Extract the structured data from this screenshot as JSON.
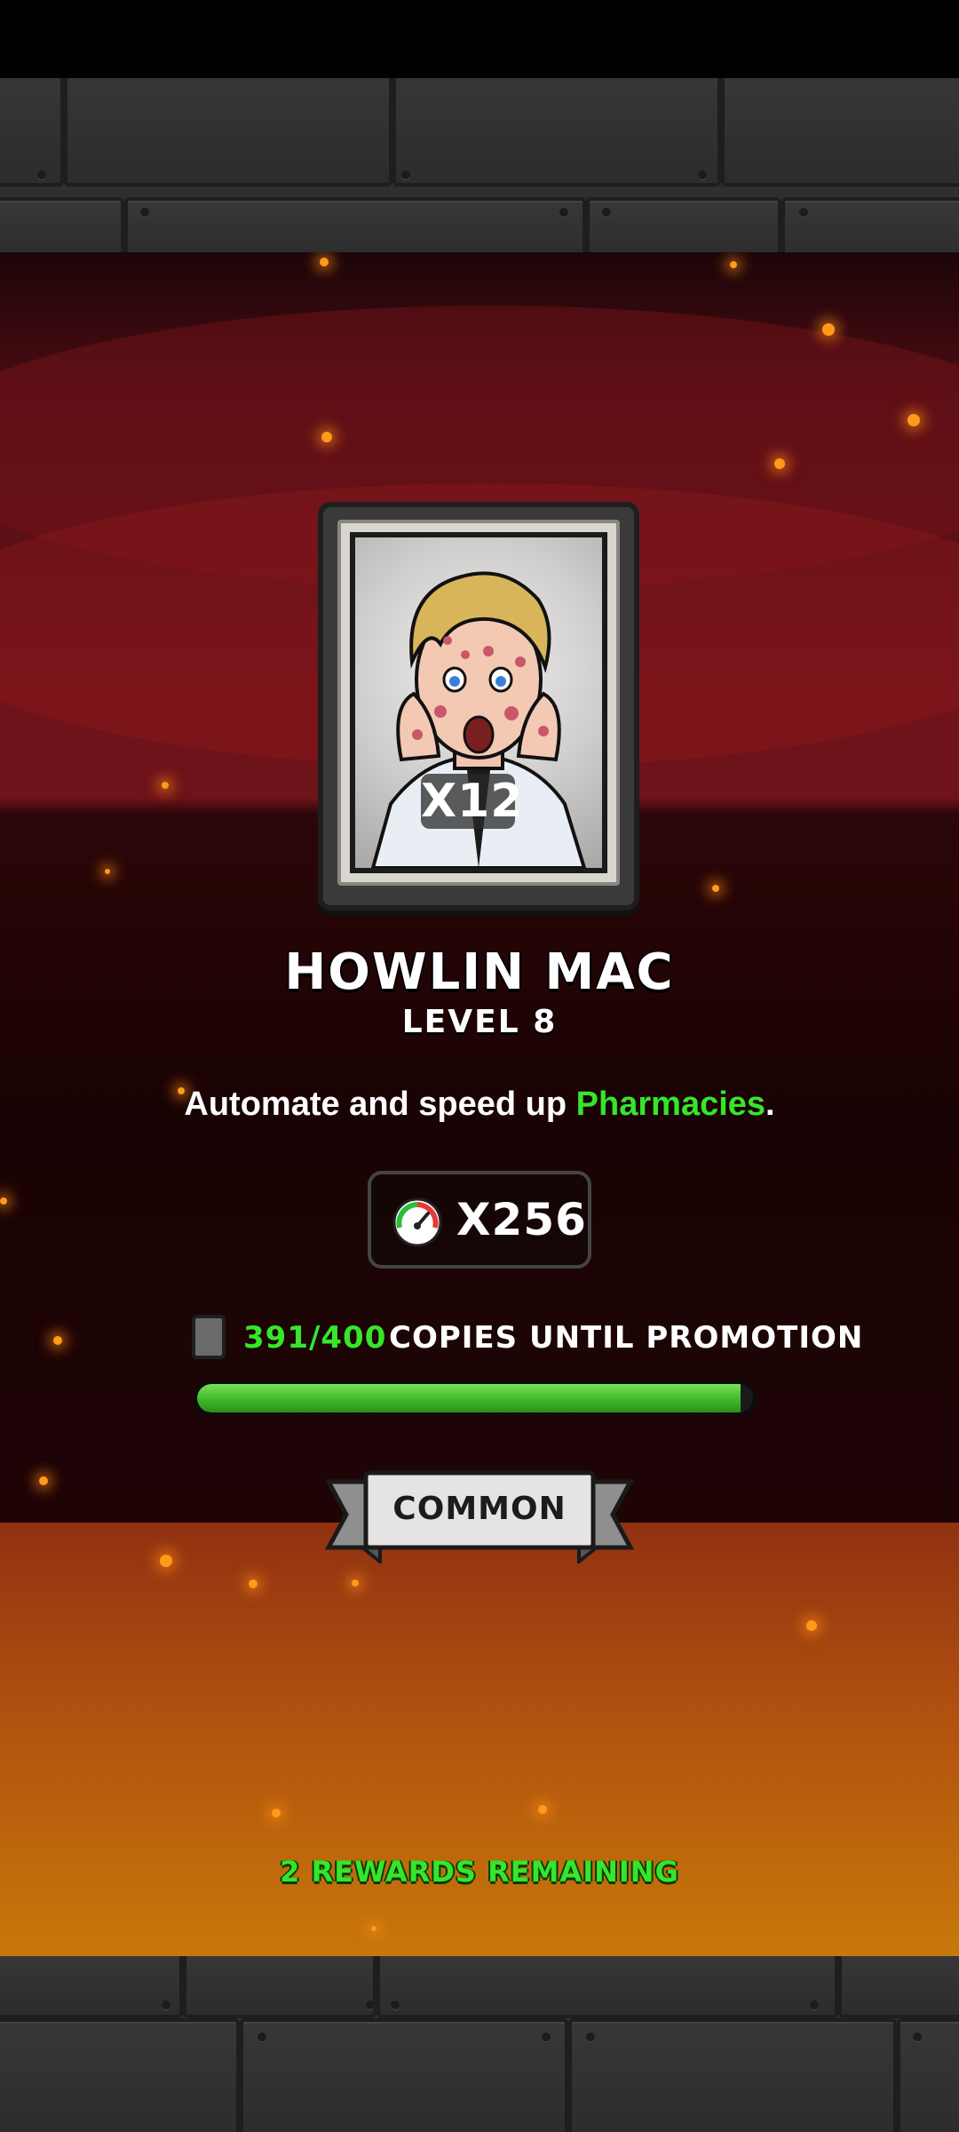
{
  "card": {
    "name": "HOWLIN MAC",
    "level": "LEVEL 8",
    "count": "X12",
    "portrait": "sick-man-portrait"
  },
  "description": {
    "prefix": "Automate and speed up ",
    "highlight": "Pharmacies",
    "suffix": "."
  },
  "boost": {
    "icon": "speedometer-icon",
    "value": "X256"
  },
  "copies": {
    "icon": "card-copy-icon",
    "count": "391/400",
    "label": "COPIES UNTIL PROMOTION",
    "progress": 0.9775
  },
  "rarity": {
    "label": "COMMON"
  },
  "footer": {
    "rewards_remaining": "2 REWARDS REMAINING"
  },
  "colors": {
    "highlight_green": "#35e62a",
    "bar_green": "#3fb928",
    "ember": "#ff9a1a"
  }
}
